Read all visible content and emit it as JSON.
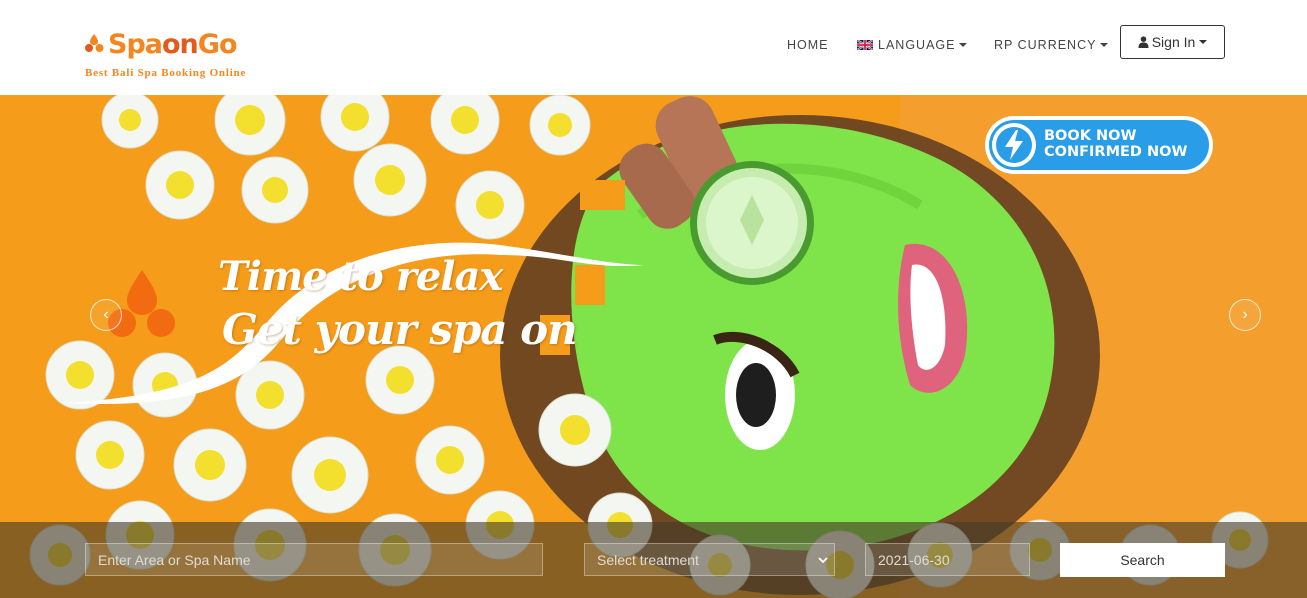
{
  "brand": {
    "name_part1": "Spa",
    "name_part2": "on",
    "name_part3": "Go",
    "tagline": "Best Bali Spa Booking Online",
    "primary_color": "#f5861f",
    "accent_color": "#e25a1c"
  },
  "nav": {
    "home": "HOME",
    "language": "LANGUAGE",
    "currency": "RP CURRENCY",
    "signin": "Sign In",
    "language_icon": "uk-flag-icon",
    "signin_icon": "user-icon"
  },
  "hero": {
    "slogan_line1": "Time to relax",
    "slogan_line2": "Get your spa on",
    "badge_line1": "BOOK NOW",
    "badge_line2": "CONFIRMED NOW",
    "badge_color": "#2a9de8",
    "background_color": "#f59c1a",
    "prev_arrow": "‹",
    "next_arrow": "›"
  },
  "search": {
    "area_placeholder": "Enter Area or Spa Name",
    "treatment_selected": "Select treatment",
    "date_value": "2021-06-30",
    "button_label": "Search"
  }
}
